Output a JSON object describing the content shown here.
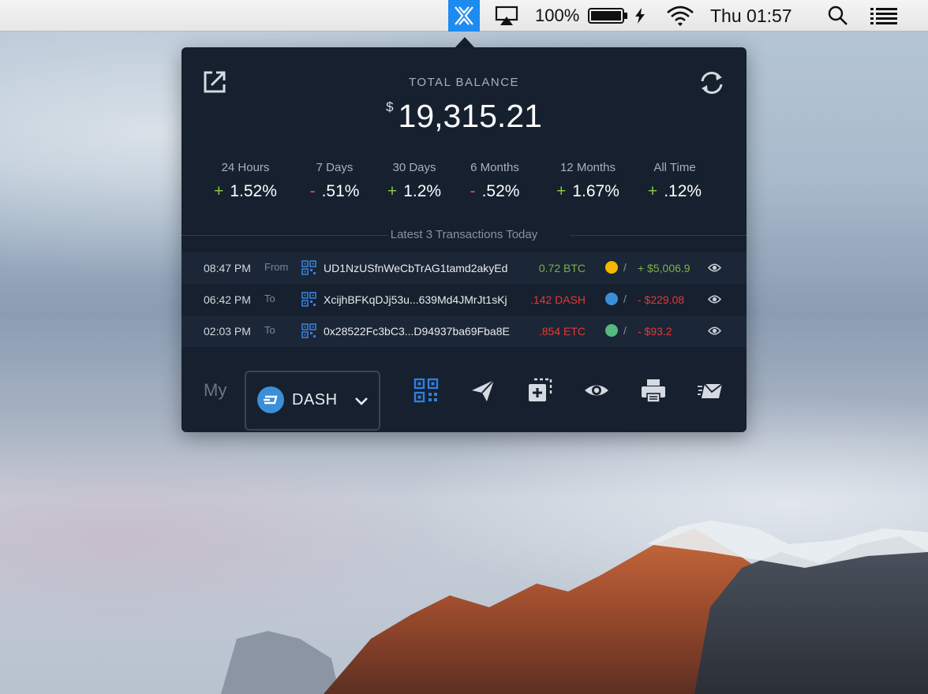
{
  "menubar": {
    "app_icon": "exodus-app-icon",
    "airplay_icon": "airplay-icon",
    "battery_percent": "100%",
    "battery_icon": "battery-icon",
    "charging_icon": "bolt-icon",
    "wifi_icon": "wifi-icon",
    "clock": "Thu 01:57",
    "search_icon": "search-icon",
    "list_icon": "notification-center-icon"
  },
  "panel": {
    "open_icon": "external-link-icon",
    "refresh_icon": "refresh-icon",
    "total_label": "TOTAL BALANCE",
    "currency_symbol": "$",
    "total_value": "19,315.21",
    "periods": [
      {
        "label": "24 Hours",
        "sign": "+",
        "value": "1.52%",
        "direction": "up"
      },
      {
        "label": "7 Days",
        "sign": "-",
        "value": ".51%",
        "direction": "down"
      },
      {
        "label": "30 Days",
        "sign": "+",
        "value": "1.2%",
        "direction": "up"
      },
      {
        "label": "6 Months",
        "sign": "-",
        "value": ".52%",
        "direction": "down"
      },
      {
        "label": "12 Months",
        "sign": "+",
        "value": "1.67%",
        "direction": "up"
      },
      {
        "label": "All Time",
        "sign": "+",
        "value": ".12%",
        "direction": "up"
      }
    ],
    "transactions_title": "Latest 3 Transactions Today",
    "transactions": [
      {
        "time": "08:47 PM",
        "direction": "From",
        "address": "UD1NzUSfnWeCbTrAG1tamd2akyEd",
        "amount": "0.72 BTC",
        "coin_icon": "bitcoin-icon",
        "coin_color": "#f5b700",
        "separator": "/",
        "fiat": "+  $5,006.9",
        "flow": "in"
      },
      {
        "time": "06:42 PM",
        "direction": "To",
        "address": "XcijhBFKqDJj53u...639Md4JMrJt1sKj",
        "amount": ".142 DASH",
        "coin_icon": "dash-icon",
        "coin_color": "#3b8fd8",
        "separator": "/",
        "fiat": "-  $229.08",
        "flow": "out"
      },
      {
        "time": "02:03 PM",
        "direction": "To",
        "address": "0x28522Fc3bC3...D94937ba69Fba8E",
        "amount": ".854 ETC",
        "coin_icon": "ethereum-classic-icon",
        "coin_color": "#55b97e",
        "separator": "/",
        "fiat": "-  $93.2",
        "flow": "out"
      }
    ],
    "my_label": "My",
    "selected_coin": "DASH",
    "actions": [
      "qr-code-icon",
      "send-icon",
      "add-wallet-icon",
      "view-icon",
      "print-icon",
      "email-icon"
    ]
  }
}
